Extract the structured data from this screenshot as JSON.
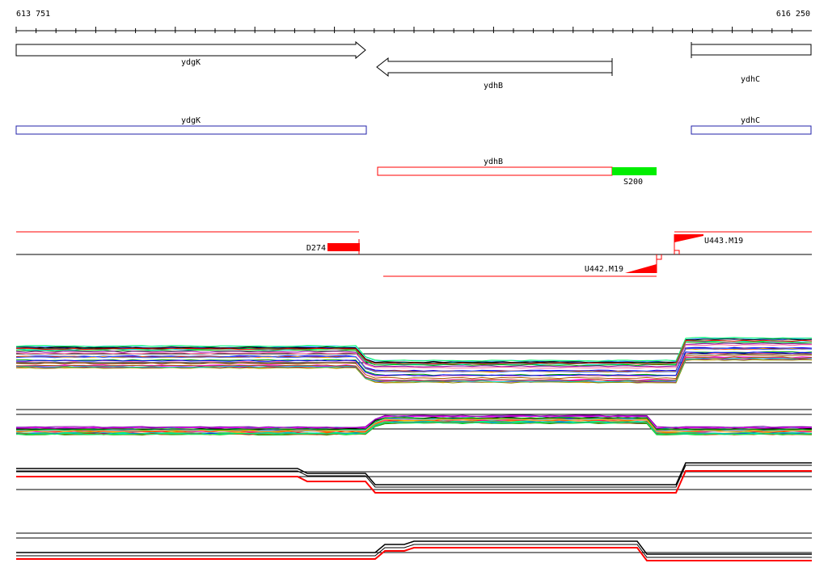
{
  "ruler": {
    "start": "613 751",
    "end": "616 250"
  },
  "genes": [
    {
      "name": "ydgK",
      "strand": "+"
    },
    {
      "name": "ydhB",
      "strand": "-"
    },
    {
      "name": "ydhC",
      "strand": "+"
    }
  ],
  "annotations": {
    "ydgK": "ydgK",
    "ydhC": "ydhC",
    "ydhB": "ydhB",
    "s_feature": "S200"
  },
  "features": {
    "d_label": "D274",
    "u443_label": "U443.M19",
    "u442_label": "U442.M19"
  },
  "colors": {
    "gene_outline": "#000000",
    "annotation_outline": "#2222aa",
    "red_feature": "#ff0000",
    "green_feature": "#00ee00"
  }
}
